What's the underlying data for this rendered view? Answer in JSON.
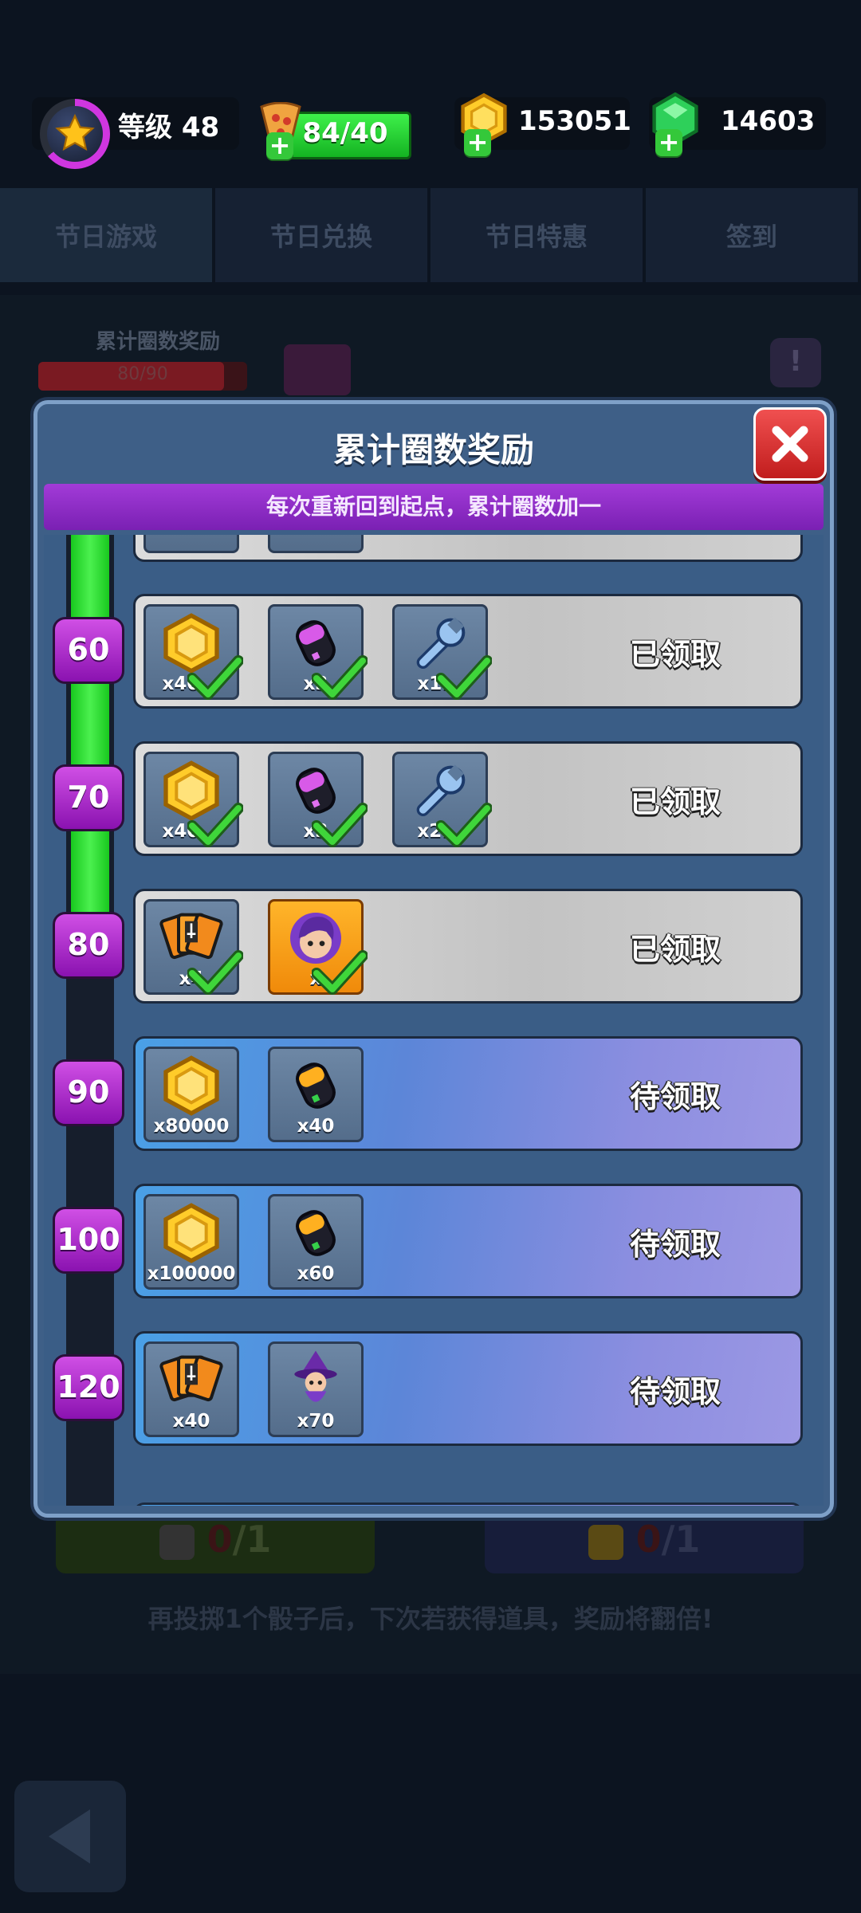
{
  "header": {
    "level_label": "等级 48",
    "level_icon": "star-icon",
    "energy": "84/40",
    "energy_icon": "pizza-icon",
    "coins": "153051",
    "gems": "14603"
  },
  "tabs": [
    "节日游戏",
    "节日兑换",
    "节日特惠",
    "签到"
  ],
  "background": {
    "label": "累计圈数奖励",
    "progress_text": "80/90",
    "progress_fraction": 0.889,
    "info_icon": "!",
    "dice_left": {
      "current": "0",
      "total": "/1"
    },
    "dice_right": {
      "current": "0",
      "total": "/1"
    },
    "hint": "再投掷1个骰子后，下次若获得道具，奖励将翻倍!"
  },
  "modal": {
    "title": "累计圈数奖励",
    "banner": "每次重新回到起点，累计圈数加一",
    "close_icon": "close-icon",
    "rows": [
      {
        "milestone": "60",
        "status": "已领取",
        "claimed": true,
        "items": [
          {
            "icon": "coin-icon",
            "qty": "x40..."
          },
          {
            "icon": "purple-canister-icon",
            "qty": "x3"
          },
          {
            "icon": "wrench-icon",
            "qty": "x1..."
          }
        ]
      },
      {
        "milestone": "70",
        "status": "已领取",
        "claimed": true,
        "items": [
          {
            "icon": "coin-icon",
            "qty": "x40..."
          },
          {
            "icon": "purple-canister-icon",
            "qty": "x3"
          },
          {
            "icon": "wrench-icon",
            "qty": "x2..."
          }
        ]
      },
      {
        "milestone": "80",
        "status": "已领取",
        "claimed": true,
        "items": [
          {
            "icon": "cards-icon",
            "qty": "x4"
          },
          {
            "icon": "hero-portrait-icon",
            "qty": "x"
          }
        ]
      },
      {
        "milestone": "90",
        "status": "待领取",
        "claimed": false,
        "items": [
          {
            "icon": "coin-icon",
            "qty": "x80000"
          },
          {
            "icon": "orange-canister-icon",
            "qty": "x40"
          }
        ]
      },
      {
        "milestone": "100",
        "status": "待领取",
        "claimed": false,
        "items": [
          {
            "icon": "coin-icon",
            "qty": "x100000"
          },
          {
            "icon": "orange-canister-icon",
            "qty": "x60"
          }
        ]
      },
      {
        "milestone": "120",
        "status": "待领取",
        "claimed": false,
        "items": [
          {
            "icon": "cards-icon",
            "qty": "x40"
          },
          {
            "icon": "witch-figure-icon",
            "qty": "x70"
          }
        ]
      }
    ]
  }
}
